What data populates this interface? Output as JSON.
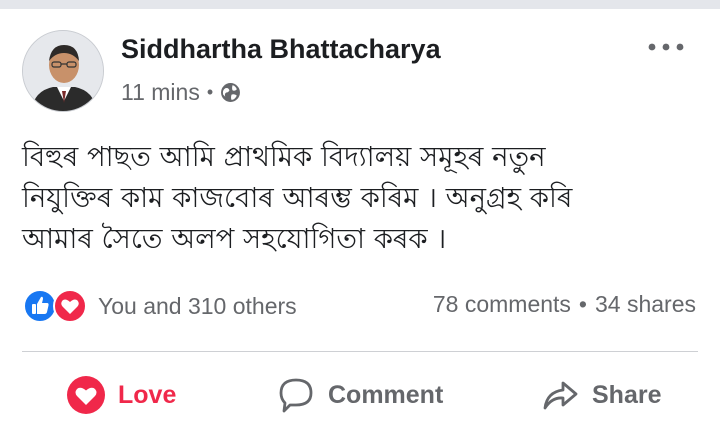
{
  "post": {
    "author": "Siddhartha Bhattacharya",
    "time": "11 mins",
    "text": "বিহুৰ পাছত আমি প্ৰাথমিক বিদ্যালয় সমূহৰ নতুন\nনিযুক্তিৰ কাম কাজবোৰ আৰম্ভ কৰিম । অনুগ্ৰহ কৰি\nআমাৰ সৈতে অলপ   সহযোগিতা কৰক ।"
  },
  "reactions": {
    "summary": "You and 310 others",
    "comments": "78 comments",
    "shares": "34 shares"
  },
  "actions": {
    "love": "Love",
    "comment": "Comment",
    "share": "Share"
  },
  "colors": {
    "like_blue": "#1877f2",
    "love_red": "#f0284a",
    "text_gray": "#65676b"
  }
}
